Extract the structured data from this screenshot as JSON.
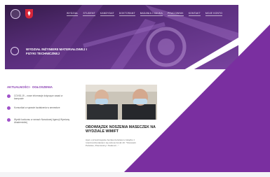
{
  "nav": {
    "items": [
      "Wydział",
      "Student",
      "Kandydat",
      "Doktorant",
      "Badania i Nauka",
      "Pracownik",
      "Kontakt",
      "Moje Konto"
    ]
  },
  "faculty": {
    "title_line1": "Wydział Inżynierii Materiałowej i",
    "title_line2": "Fizyki Technicznej"
  },
  "news": {
    "heading": "Aktualności · Ogłoszenia",
    "items": [
      {
        "text": "COVID-19 – nowe informacje dotyczące zasad w kampusie"
      },
      {
        "text": "Komunikat w sprawie kształcenia w semestrze"
      },
      {
        "text": "Wyniki konkursu w ramach Narodowej Agencji Wymiany Akademickiej"
      }
    ]
  },
  "article": {
    "title": "Obowiązek noszenia maseczek na Wydziale WIMiFT",
    "body": "Apel o przestrzeganie bezpieczeństwa w związku z rozprzestrzenianiem się wirusa Covid-19. \"Szanowni Państwo, Pracownicy i Studenci...\""
  },
  "colors": {
    "brand_purple": "#7a2fa0",
    "accent": "#a052c9"
  }
}
